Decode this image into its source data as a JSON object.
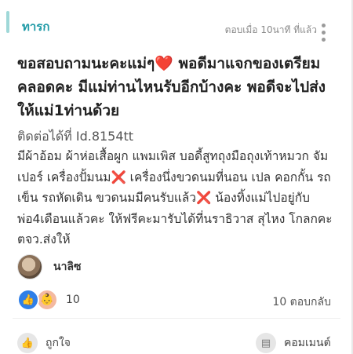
{
  "post": {
    "tag": "ทารก",
    "meta": "ตอบเมื่อ 10นาที ที่แล้ว",
    "title_part1": "ขอสอบถามนะคะแม่ๆ",
    "heart_glyph": "❤️",
    "title_part2": " พอดีมาแจกของเตรียมคลอดคะ มีแม่ท่านไหนรับอีกบ้างคะ พอดีจะไปส่งให้แม่1ท่านด้วย",
    "contact": "ติดต่อได้ที่ Id.8154tt",
    "body_part1": "มีผ้าอ้อม ผ้าห่อเสื้อผูก แพมเพิส บอดี้สูทถุงมือถุงเท้าหมวก จัมเปอร์ เครื่องปั้มนม",
    "x_glyph": "❌",
    "body_part2": " เครื่องนึ่งขวดนมที่นอน เปล คอกกั้น รถเข็น รถหัดเดิน ขวดนมมีคนรับแล้ว",
    "body_part3": " น้องทิ้งแม่ไปอยู่กับพ่อ4เดือนแล้วคะ ให้ฟรีคะมารับได้ที่นราธิวาส สุไหง โกลกคะ ตจว.ส่งให้"
  },
  "author": {
    "name": "นาลิซ"
  },
  "reactions": {
    "like_icon": "thumbs-up-icon",
    "baby_icon": "baby-face-icon",
    "count": "10",
    "replies": "10 ตอบกลับ"
  },
  "actions": {
    "like_label": "ถูกใจ",
    "comment_label": "คอมเมนต์"
  },
  "colors": {
    "tag": "#1f9aa6",
    "like_blue": "#2f7fe8"
  }
}
